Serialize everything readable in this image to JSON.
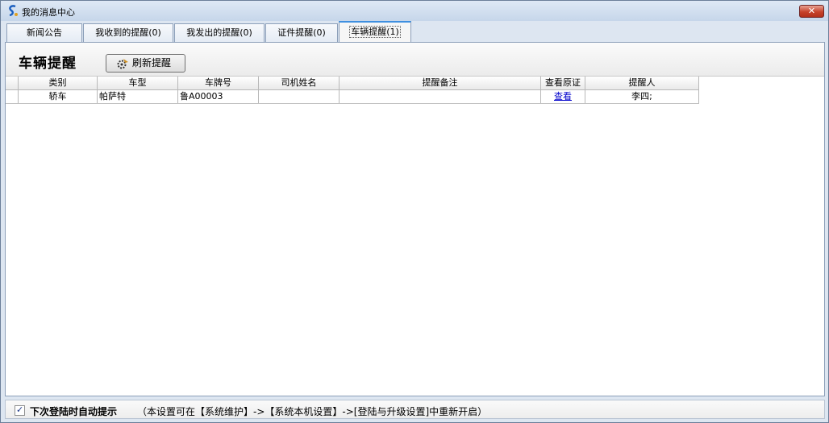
{
  "window": {
    "title": "我的消息中心",
    "close_symbol": "✕"
  },
  "tabs": [
    {
      "label": "新闻公告",
      "active": false
    },
    {
      "label": "我收到的提醒(0)",
      "active": false
    },
    {
      "label": "我发出的提醒(0)",
      "active": false
    },
    {
      "label": "证件提醒(0)",
      "active": false
    },
    {
      "label": "车辆提醒(1)",
      "active": true
    }
  ],
  "section": {
    "title": "车辆提醒",
    "refresh_label": "刷新提醒",
    "refresh_icon": "gear-arrow-icon"
  },
  "grid": {
    "columns": [
      "类别",
      "车型",
      "车牌号",
      "司机姓名",
      "提醒备注",
      "查看原证",
      "提醒人"
    ],
    "rows": [
      {
        "category": "轿车",
        "model": "帕萨特",
        "plate": "鲁A00003",
        "driver": "",
        "note": "",
        "view": "查看",
        "reminder": "李四;"
      }
    ]
  },
  "footer": {
    "checked": true,
    "label": "下次登陆时自动提示",
    "note": "（本设置可在【系统维护】->【系统本机设置】->[登陆与升级设置]中重新开启）"
  },
  "colors": {
    "active_tab_accent": "#3e8fe0",
    "link": "#0000cc",
    "close_button": "#c7422b"
  }
}
